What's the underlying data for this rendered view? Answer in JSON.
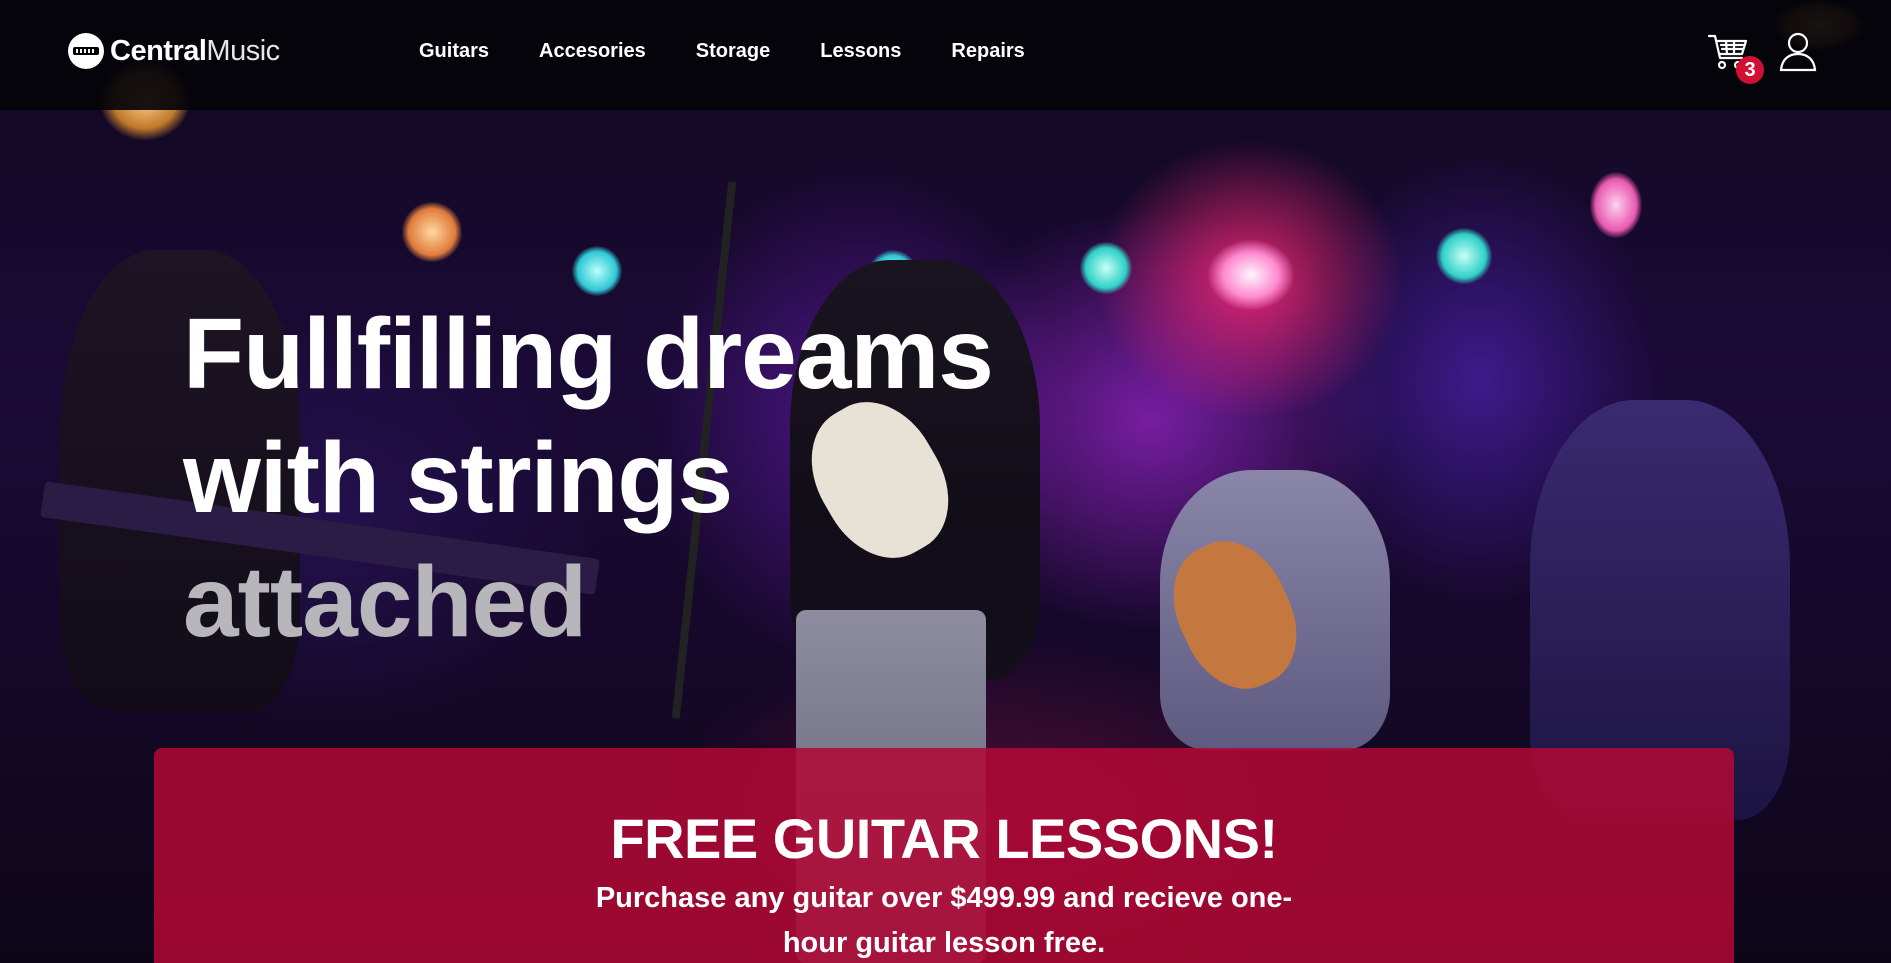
{
  "brand": {
    "name_bold": "Central",
    "name_light": "Music"
  },
  "nav": {
    "items": [
      {
        "label": "Guitars"
      },
      {
        "label": "Accesories"
      },
      {
        "label": "Storage"
      },
      {
        "label": "Lessons"
      },
      {
        "label": "Repairs"
      }
    ]
  },
  "header_actions": {
    "cart_icon": "shopping-cart-icon",
    "cart_count": "3",
    "user_icon": "user-icon"
  },
  "hero": {
    "headline_line1": "Fullfilling dreams",
    "headline_line2": "with strings",
    "headline_line3": "attached"
  },
  "promo": {
    "title": "FREE GUITAR LESSONS!",
    "body_line1": "Purchase any guitar over $499.99 and recieve one-",
    "body_line2": "hour guitar lesson free."
  },
  "colors": {
    "navbar_bg": "#05040a",
    "promo_bg": "#b20834",
    "badge_bg": "#d21034",
    "headline_muted": "#b7b7bb"
  }
}
